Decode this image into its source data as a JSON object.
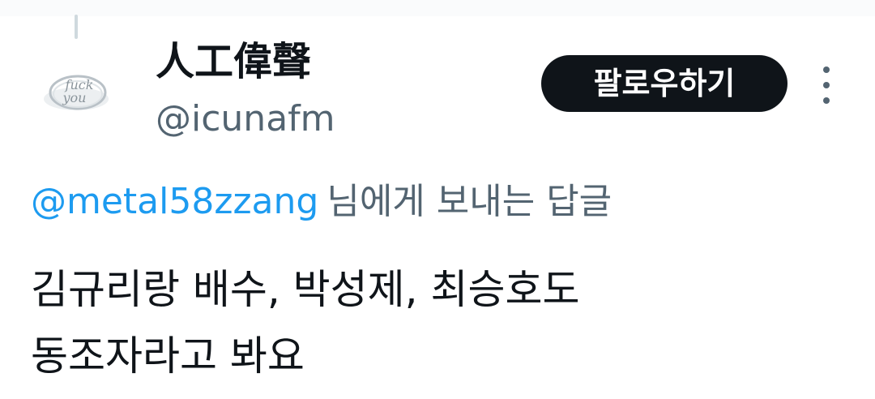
{
  "author": {
    "display_name": "人工偉聲",
    "handle": "@icunafm",
    "avatar_text": [
      "fuck",
      "you"
    ]
  },
  "follow_button": {
    "label": "팔로우하기"
  },
  "more_button": {
    "icon": "more-vertical-icon"
  },
  "reply_to": {
    "mention": "@metal58zzang",
    "suffix": "님에게 보내는 답글"
  },
  "tweet": {
    "lines": [
      "김규리랑 배수, 박성제, 최승호도",
      "동조자라고 봐요"
    ]
  },
  "colors": {
    "text_primary": "#0f1419",
    "text_secondary": "#536471",
    "link": "#1d9bf0",
    "button_bg": "#0f1419",
    "button_text": "#ffffff"
  }
}
